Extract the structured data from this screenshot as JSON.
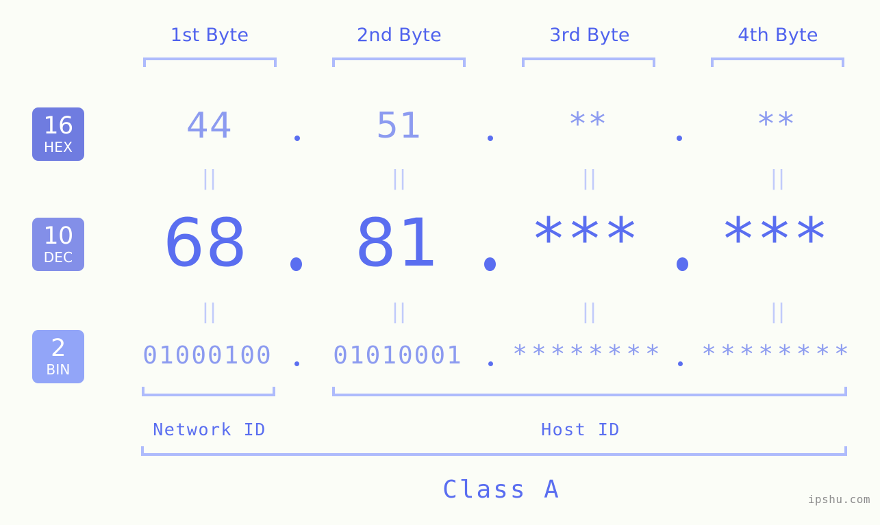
{
  "meta": {
    "watermark": "ipshu.com"
  },
  "byte_headers": [
    {
      "label": "1st Byte"
    },
    {
      "label": "2nd Byte"
    },
    {
      "label": "3rd Byte"
    },
    {
      "label": "4th Byte"
    }
  ],
  "rows": [
    {
      "id": "hex",
      "badge_number": "16",
      "badge_name": "HEX",
      "badge_color": "#6f7ce0",
      "values": [
        "44",
        "51",
        "**",
        "**"
      ],
      "separator": "."
    },
    {
      "id": "dec",
      "badge_number": "10",
      "badge_name": "DEC",
      "badge_color": "#838fe8",
      "values": [
        "68",
        "81",
        "***",
        "***"
      ],
      "separator": "."
    },
    {
      "id": "bin",
      "badge_number": "2",
      "badge_name": "BIN",
      "badge_color": "#92a5f8",
      "values": [
        "01000100",
        "01010001",
        "********",
        "********"
      ],
      "separator": "."
    }
  ],
  "equals_marks": {
    "symbol": "||",
    "color": "#c1cbfb"
  },
  "segments": {
    "network_id": "Network ID",
    "host_id": "Host ID"
  },
  "class": {
    "label": "Class A"
  },
  "colors": {
    "background": "#fbfdf7",
    "bracket": "#aebbfc",
    "accent_strong": "#5a6ef0",
    "accent_light": "#8c9bf0",
    "header_text": "#4f62ed"
  }
}
